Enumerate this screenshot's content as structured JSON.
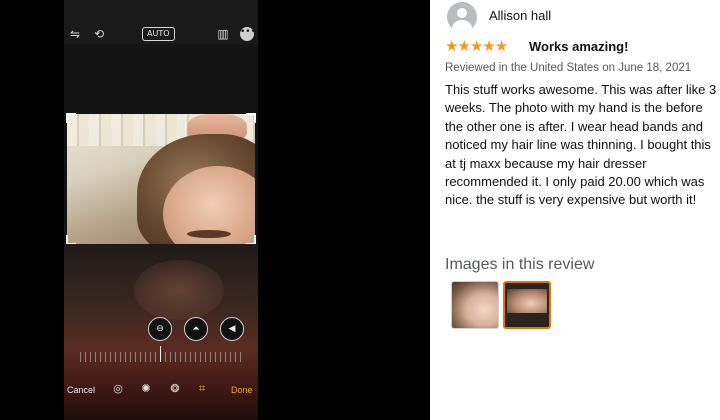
{
  "editor": {
    "top_icons": [
      "flip-icon",
      "rotate-icon",
      "auto-badge",
      "aspect-ratio-icon",
      "more-icon"
    ],
    "auto_label": "AUTO",
    "more_glyph": "•••",
    "adjust_controls": [
      "straighten-icon",
      "vertical-perspective-icon",
      "horizontal-perspective-icon"
    ],
    "cancel_label": "Cancel",
    "done_label": "Done",
    "tools": [
      "live-icon",
      "adjust-icon",
      "filters-icon",
      "crop-icon"
    ],
    "active_tool": "crop-icon",
    "accent": "#e6b300"
  },
  "review": {
    "author": "Allison hall",
    "rating": 5,
    "stars_text": "★★★★★",
    "star_color": "#f39a1e",
    "title": "Works amazing!",
    "meta": "Reviewed in the United States on June 18, 2021",
    "body": "This stuff works awesome. This was after like 3 weeks. The photo with my hand is the before the other one is after. I wear head bands and noticed my hair line was thinning. I bought this at tj maxx because my hair dresser recommended it. I only paid 20.00 which was nice. the stuff is very expensive but worth it!",
    "images_heading": "Images in this review",
    "image_count": 2,
    "selected_image_index": 2
  }
}
